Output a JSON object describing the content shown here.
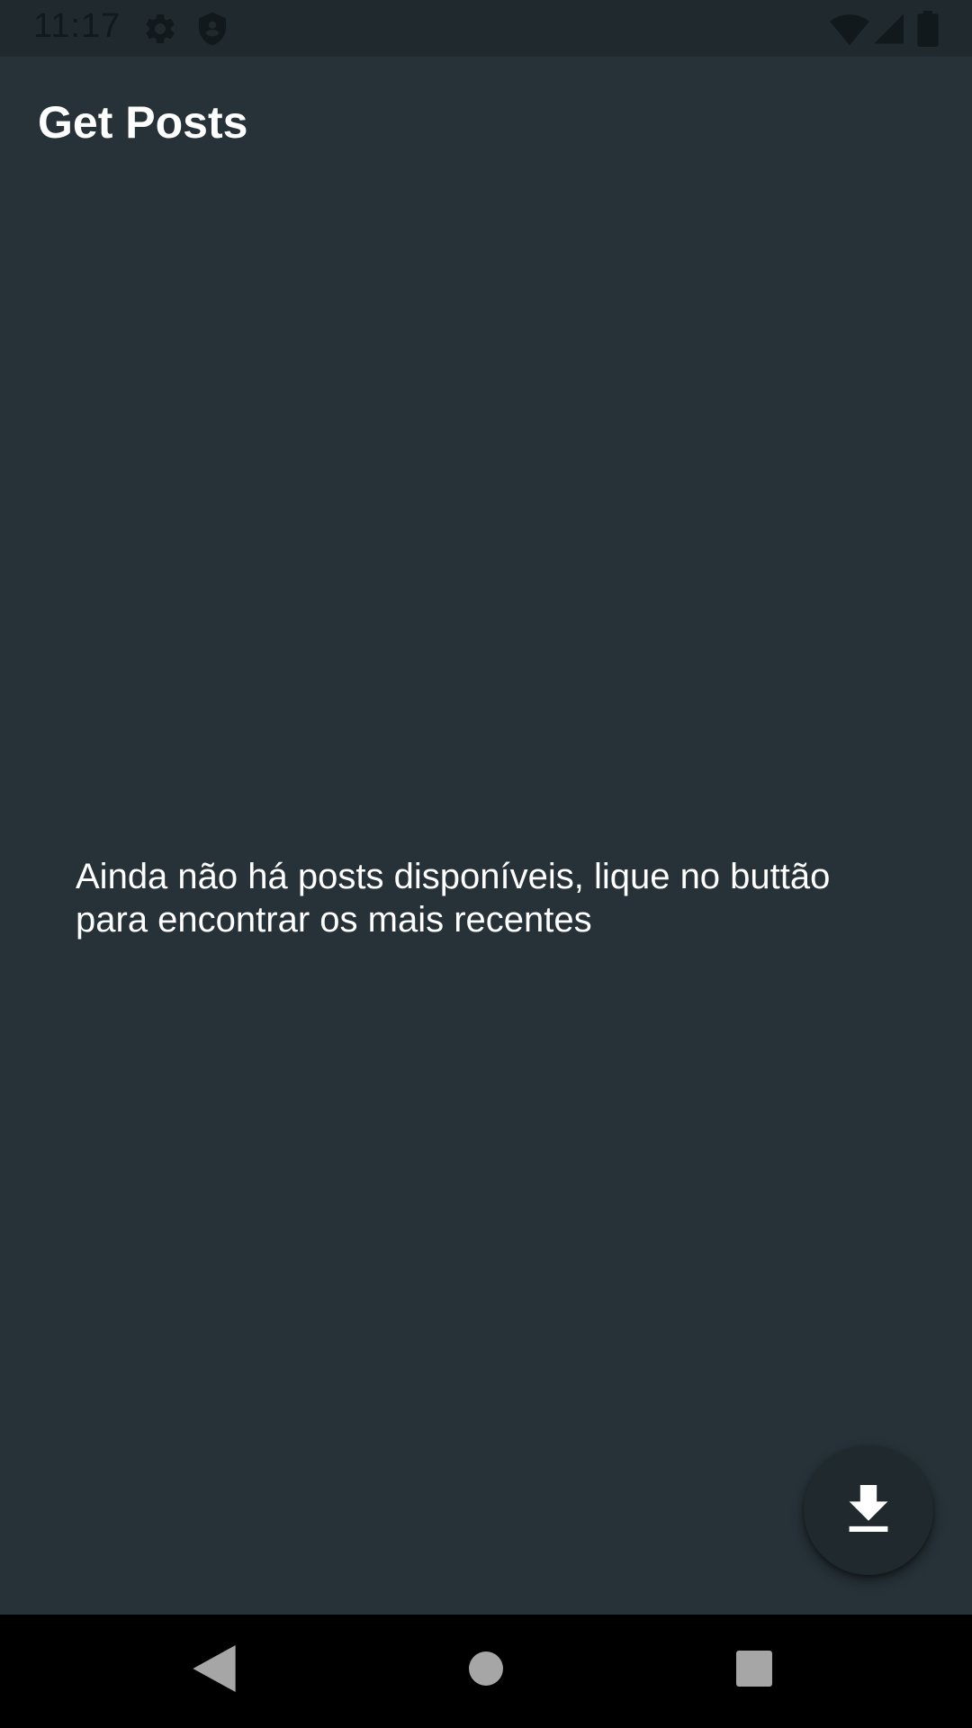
{
  "status_bar": {
    "time": "11:17",
    "icons": [
      "gear-icon",
      "shield-icon",
      "wifi-icon",
      "signal-icon",
      "battery-icon"
    ]
  },
  "app_bar": {
    "title": "Get Posts"
  },
  "main": {
    "empty_message": "Ainda não há posts disponíveis, lique no buttão para encontrar os mais recentes"
  },
  "fab": {
    "icon": "download-icon"
  },
  "nav_bar": {
    "buttons": [
      "back-icon",
      "home-icon",
      "recents-icon"
    ]
  },
  "colors": {
    "background": "#263238",
    "status_bar": "#1f292e",
    "fab": "#20292e",
    "nav_bar": "#000000",
    "text": "#ffffff"
  }
}
